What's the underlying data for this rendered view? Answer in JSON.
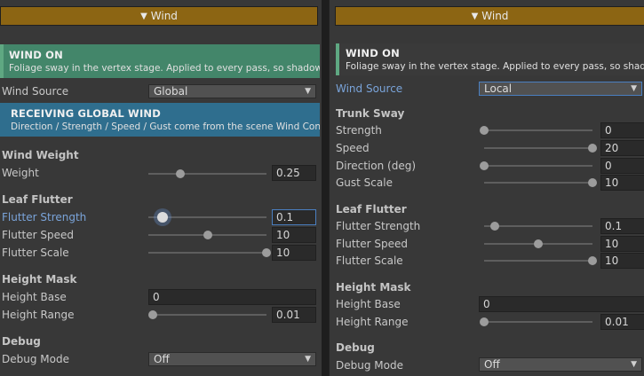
{
  "left": {
    "foldout": "Wind",
    "wind_on": {
      "title": "WIND ON",
      "text": "Foliage sway in the vertex stage. Applied to every pass, so shadows ar"
    },
    "wind_source": {
      "label": "Wind Source",
      "value": "Global"
    },
    "receiving": {
      "title": "RECEIVING GLOBAL WIND",
      "text": "Direction / Strength / Speed / Gust come from the scene Wind Controll"
    },
    "wind_weight": {
      "section": "Wind Weight",
      "weight_label": "Weight",
      "weight_value": "0.25",
      "weight_fraction": 0.27
    },
    "leaf_flutter": {
      "section": "Leaf Flutter",
      "rows": [
        {
          "label": "Flutter Strength",
          "value": "0.1",
          "fraction": 0.12
        },
        {
          "label": "Flutter Speed",
          "value": "10",
          "fraction": 0.5
        },
        {
          "label": "Flutter Scale",
          "value": "10",
          "fraction": 1.0
        }
      ]
    },
    "height_mask": {
      "section": "Height Mask",
      "base_label": "Height Base",
      "base_value": "0",
      "range_label": "Height Range",
      "range_value": "0.01",
      "range_fraction": 0.0
    },
    "debug": {
      "section": "Debug",
      "mode_label": "Debug Mode",
      "mode_value": "Off"
    }
  },
  "right": {
    "foldout": "Wind",
    "wind_on": {
      "title": "WIND ON",
      "text": "Foliage sway in the vertex stage. Applied to every pass, so shadows ar"
    },
    "wind_source": {
      "label": "Wind Source",
      "value": "Local"
    },
    "trunk_sway": {
      "section": "Trunk Sway",
      "rows": [
        {
          "label": "Strength",
          "value": "0",
          "fraction": 0.0
        },
        {
          "label": "Speed",
          "value": "20",
          "fraction": 1.0
        },
        {
          "label": "Direction (deg)",
          "value": "0",
          "fraction": 0.0
        },
        {
          "label": "Gust Scale",
          "value": "10",
          "fraction": 1.0
        }
      ]
    },
    "leaf_flutter": {
      "section": "Leaf Flutter",
      "rows": [
        {
          "label": "Flutter Strength",
          "value": "0.1",
          "fraction": 0.1
        },
        {
          "label": "Flutter Speed",
          "value": "10",
          "fraction": 0.5
        },
        {
          "label": "Flutter Scale",
          "value": "10",
          "fraction": 1.0
        }
      ]
    },
    "height_mask": {
      "section": "Height Mask",
      "base_label": "Height Base",
      "base_value": "0",
      "range_label": "Height Range",
      "range_value": "0.01",
      "range_fraction": 0.0
    },
    "debug": {
      "section": "Debug",
      "mode_label": "Debug Mode",
      "mode_value": "Off"
    }
  }
}
